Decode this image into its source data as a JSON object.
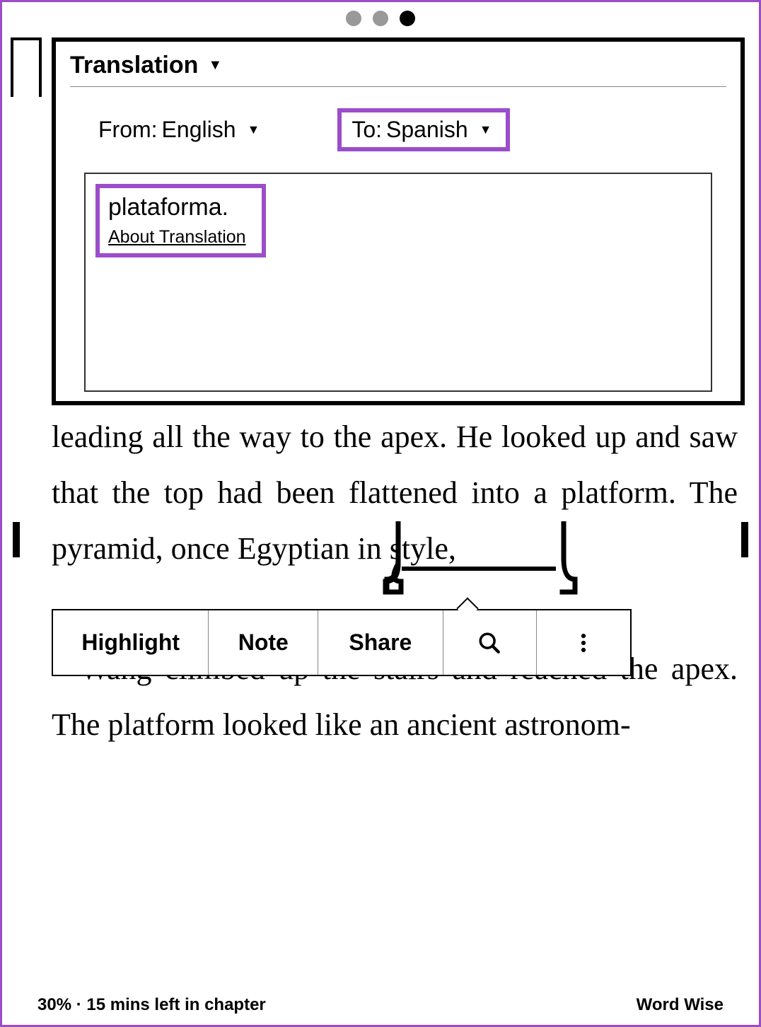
{
  "pagination": {
    "dots": [
      {
        "active": false
      },
      {
        "active": false
      },
      {
        "active": true
      }
    ]
  },
  "translation": {
    "title": "Translation",
    "from_label": "From:",
    "from_lang": "English",
    "to_label": "To:",
    "to_lang": "Spanish",
    "result": "plataforma.",
    "about_link": "About Translation"
  },
  "book": {
    "paragraph1": "leading all the way to the apex. He looked up and saw that the top had been flattened into a platform. The pyramid, once Egyptian in style,",
    "paragraph2": "Wang climbed up the stairs and reached the apex. The platform looked like an ancient astronom-",
    "selected_word": "platform."
  },
  "toolbar": {
    "highlight": "Highlight",
    "note": "Note",
    "share": "Share",
    "search_icon": "search-icon",
    "more_icon": "more-vertical-icon"
  },
  "footer": {
    "progress": "30% · 15 mins left in chapter",
    "wordwise": "Word Wise"
  }
}
